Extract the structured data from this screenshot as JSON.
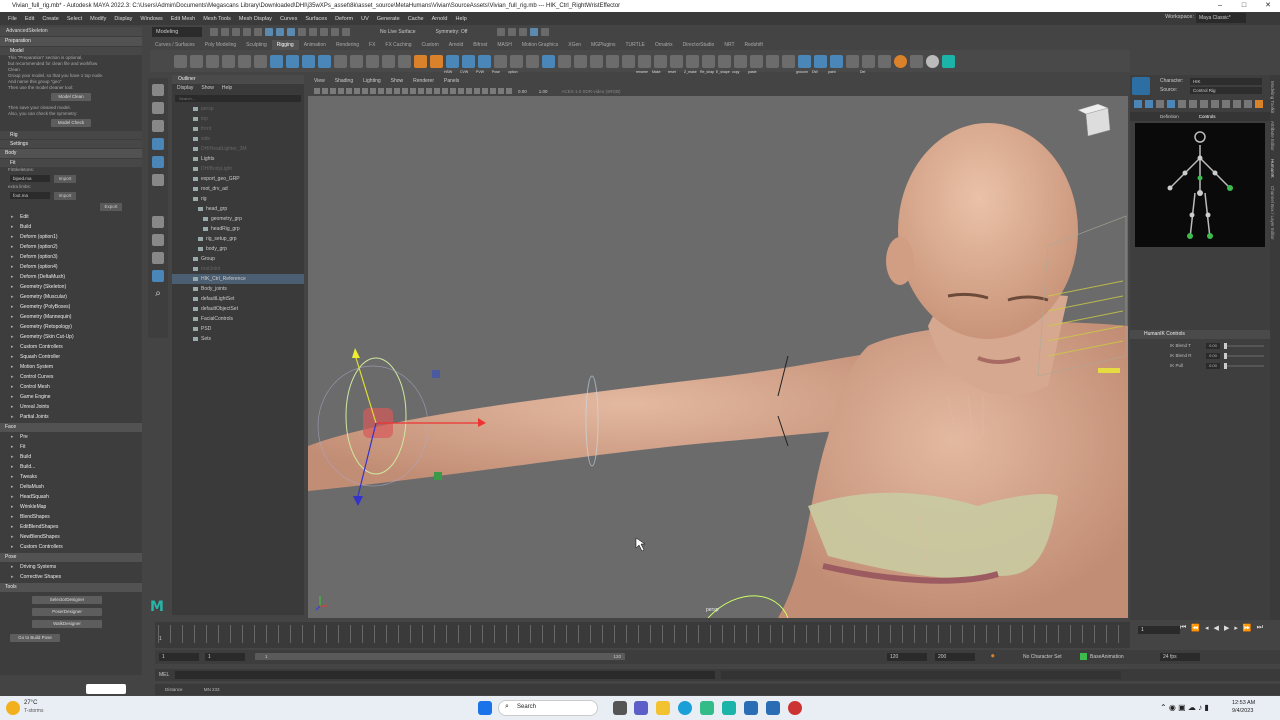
{
  "window": {
    "title": "Vivian_full_rig.mb* - Autodesk MAYA 2022.3: C:\\Users\\Admin\\Documents\\Megascans Library\\Downloaded\\DHI\\j35wXPs_asset\\8k\\asset_source\\MetaHumans\\Vivian\\SourceAssets\\Vivian_full_rig.mb --- HIK_Ctrl_RightWristEffector"
  },
  "menubar": {
    "items": [
      "File",
      "Edit",
      "Create",
      "Select",
      "Modify",
      "Display",
      "Windows",
      "Edit Mesh",
      "Mesh Tools",
      "Mesh Display",
      "Curves",
      "Surfaces",
      "Deform",
      "UV",
      "Generate",
      "Cache",
      "Arnold",
      "Help"
    ],
    "workspace_label": "Workspace:",
    "workspace_value": "Maya Classic*"
  },
  "statusline": {
    "mode": "Modeling",
    "no_live_surface": "No Live Surface",
    "symmetry": "Symmetry: Off"
  },
  "shelf": {
    "tabs": [
      "Curves / Surfaces",
      "Poly Modeling",
      "Sculpting",
      "Rigging",
      "Animation",
      "Rendering",
      "FX",
      "FX Caching",
      "Custom",
      "Arnold",
      "Bifrost",
      "MASH",
      "Motion Graphics",
      "XGen",
      "MGPlugins",
      "TURTLE",
      "Ornatrix",
      "DirectorStudio",
      "NRT",
      "Redshift"
    ],
    "active_tab": "Rigging",
    "labels": [
      "HSW",
      "CVW",
      "PVW",
      "Pose",
      "option",
      "rename",
      "Make",
      "reset",
      "Z_make",
      "Re_shap",
      "E_shape",
      "copy",
      "paste",
      "grooom",
      "DW",
      "paint",
      "Del"
    ]
  },
  "left_panel": {
    "header": "AdvancedSkeleton",
    "preparation": "Preparation",
    "model": "Model",
    "info_lines": [
      "This \"Preparation\" section is optional,",
      "but recommended for clean file and workflow",
      "Clean",
      "Group your model, so that you have 1 top node.",
      "And name this group \"geo\"",
      "Then use the model cleaner tool:"
    ],
    "model_clean_btn": "Model Clean",
    "check_lines": [
      "Then save your cleaned model.",
      "Also, you can check the symmetry:"
    ],
    "model_check_btn": "Model Check",
    "rig": "Rig",
    "settings": "Settings",
    "body": "Body",
    "fit": "Fit",
    "fit_skeletons": "FitSkeletons:",
    "fit_value": "biped.ma",
    "import_btn": "Import",
    "extra_limbs": "extra limbs:",
    "extra_value": "foot.ma",
    "import_btn2": "Import",
    "export_btn": "Export",
    "body_items": [
      "Edit",
      "Build",
      "Deform    (option1)",
      "Deform    (option2)",
      "Deform    (option3)",
      "Deform    (option4)",
      "Deform    (DeltaMush)",
      "Geometry (Skeleton)",
      "Geometry (Muscular)",
      "Geometry (PolyBoxes)",
      "Geometry (Mannequin)",
      "Geometry (Retopology)",
      "Geometry (Skin Cut-Up)",
      "Custom Controllers",
      "Squash Controller",
      "Motion System",
      "Control Curves",
      "Control Mesh",
      "Game Engine",
      "Unreal Joints",
      "Partial Joints"
    ],
    "face": "Face",
    "face_items": [
      "Pre",
      "Fit",
      "Build",
      "Build...",
      "Tweaks",
      "DeltaMush",
      "HeadSquash",
      "WrinkleMap",
      "BlendShapes",
      "EditBlendShapes",
      "NewBlendShapes",
      "Custom Controllers"
    ],
    "pose": "Pose",
    "pose_items": [
      "Driving Systems",
      "Corrective Shapes"
    ],
    "tools": "Tools",
    "tool_buttons": [
      "SelectorDesigner",
      "PoserDesigner",
      "WalkDesigner"
    ],
    "build_pose": "Go to Build Pose"
  },
  "outliner": {
    "title": "Outliner",
    "menu": [
      "Display",
      "Show",
      "Help"
    ],
    "search_placeholder": "Search...",
    "rows": [
      {
        "label": "persp",
        "indent": 1,
        "dim": true
      },
      {
        "label": "top",
        "indent": 1,
        "dim": true
      },
      {
        "label": "front",
        "indent": 1,
        "dim": true
      },
      {
        "label": "side",
        "indent": 1,
        "dim": true
      },
      {
        "label": "DHIHeadLighter_3M",
        "indent": 1,
        "dim": true
      },
      {
        "label": "Lights",
        "indent": 1,
        "dim": false
      },
      {
        "label": "DHIBodyLight",
        "indent": 1,
        "dim": true
      },
      {
        "label": "export_geo_GRP",
        "indent": 1,
        "dim": false
      },
      {
        "label": "root_drv_ad",
        "indent": 1,
        "dim": false
      },
      {
        "label": "rig",
        "indent": 1,
        "dim": false
      },
      {
        "label": "head_grp",
        "indent": 2,
        "dim": false
      },
      {
        "label": "geometry_grp",
        "indent": 3,
        "dim": false
      },
      {
        "label": "headRig_grp",
        "indent": 3,
        "dim": false
      },
      {
        "label": "rig_setup_grp",
        "indent": 2,
        "dim": false
      },
      {
        "label": "body_grp",
        "indent": 2,
        "dim": false
      },
      {
        "label": "Group",
        "indent": 1,
        "dim": false
      },
      {
        "label": "rootJoint",
        "indent": 1,
        "dim": true
      },
      {
        "label": "HIK_Ctrl_Reference",
        "indent": 1,
        "dim": false,
        "selected": true
      },
      {
        "label": "Body_joints",
        "indent": 1,
        "dim": false
      },
      {
        "label": "defaultLightSet",
        "indent": 1,
        "dim": false
      },
      {
        "label": "defaultObjectSet",
        "indent": 1,
        "dim": false
      },
      {
        "label": "FacialControls",
        "indent": 1,
        "dim": false
      },
      {
        "label": "PSD",
        "indent": 1,
        "dim": false
      },
      {
        "label": "Sets",
        "indent": 1,
        "dim": false
      }
    ]
  },
  "viewport": {
    "menu": [
      "View",
      "Shading",
      "Lighting",
      "Show",
      "Renderer",
      "Panels"
    ],
    "field1": "0.00",
    "field2": "1.00",
    "color_space": "ACES 1.0 SDR-video (sRGB)",
    "camera_label": "persp"
  },
  "right_panel": {
    "character_label": "Character:",
    "character_value": "HIK",
    "source_label": "Source:",
    "source_value": "Control Rig",
    "tab_definition": "Definition",
    "tab_controls": "Controls",
    "hik_controls": "HumanIK Controls",
    "ik_rows": [
      {
        "label": "IK Blend T",
        "value": "0.00"
      },
      {
        "label": "IK Blend R",
        "value": "0.00"
      },
      {
        "label": "IK Pull",
        "value": "0.00"
      }
    ],
    "side_tabs": [
      "Modeling Toolkit",
      "Attribute Editor",
      "HumanIK",
      "Channel Box / Layer Editor"
    ]
  },
  "timeline": {
    "ticks": [
      "1",
      "",
      "",
      "",
      "",
      "",
      "",
      "",
      "",
      "",
      "",
      "",
      "",
      "",
      "",
      "",
      "",
      "",
      "",
      "",
      "",
      "120"
    ],
    "current_frame": "1"
  },
  "range": {
    "start": "1",
    "inner_start": "1",
    "inner_end": "120",
    "end": "120",
    "end2": "200",
    "character_set": "No Character Set",
    "anim_layer": "BaseAnimation",
    "fps": "24 fps"
  },
  "cmdline": {
    "label": "MEL"
  },
  "helpline": {
    "label": "Distance",
    "value": "MN 233"
  },
  "taskbar": {
    "weather_temp": "27°C",
    "weather_desc": "T-storms",
    "search": "Search",
    "time": "12:53 AM",
    "date": "9/4/2023"
  }
}
